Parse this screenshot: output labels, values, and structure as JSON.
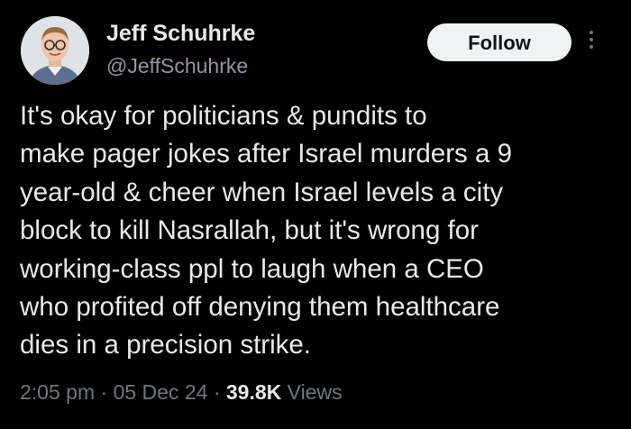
{
  "author": {
    "display_name": "Jeff Schuhrke",
    "handle": "@JeffSchuhrke"
  },
  "actions": {
    "follow_label": "Follow",
    "more_icon": "more-vertical-icon"
  },
  "tweet": {
    "lines": [
      "It's okay for politicians & pundits to",
      "make pager jokes after Israel murders a 9",
      "year-old & cheer when Israel levels a city",
      "block to kill Nasrallah, but it's wrong for",
      "working-class ppl to laugh when a CEO",
      "who profited off denying them healthcare",
      "dies in a precision strike."
    ]
  },
  "meta": {
    "time": "2:05 pm",
    "separator": "·",
    "date": "05 Dec 24",
    "views_count": "39.8K",
    "views_label": "Views"
  },
  "colors": {
    "background": "#000000",
    "primary_text": "#e7e9ea",
    "secondary_text": "#71767b",
    "button_bg": "#eff3f4"
  }
}
